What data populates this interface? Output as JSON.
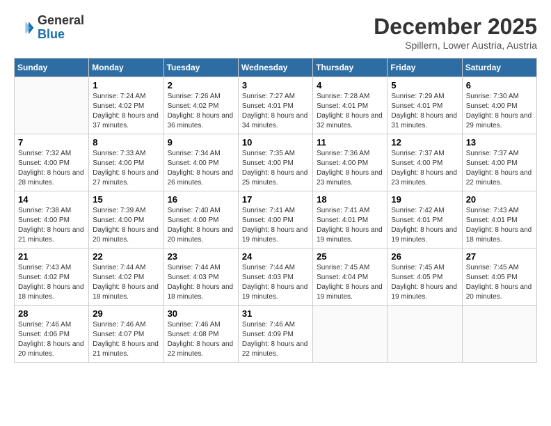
{
  "header": {
    "logo": {
      "general": "General",
      "blue": "Blue"
    },
    "title": "December 2025",
    "location": "Spillern, Lower Austria, Austria"
  },
  "weekdays": [
    "Sunday",
    "Monday",
    "Tuesday",
    "Wednesday",
    "Thursday",
    "Friday",
    "Saturday"
  ],
  "weeks": [
    [
      {
        "day": "",
        "sunrise": "",
        "sunset": "",
        "daylight": ""
      },
      {
        "day": "1",
        "sunrise": "Sunrise: 7:24 AM",
        "sunset": "Sunset: 4:02 PM",
        "daylight": "Daylight: 8 hours and 37 minutes."
      },
      {
        "day": "2",
        "sunrise": "Sunrise: 7:26 AM",
        "sunset": "Sunset: 4:02 PM",
        "daylight": "Daylight: 8 hours and 36 minutes."
      },
      {
        "day": "3",
        "sunrise": "Sunrise: 7:27 AM",
        "sunset": "Sunset: 4:01 PM",
        "daylight": "Daylight: 8 hours and 34 minutes."
      },
      {
        "day": "4",
        "sunrise": "Sunrise: 7:28 AM",
        "sunset": "Sunset: 4:01 PM",
        "daylight": "Daylight: 8 hours and 32 minutes."
      },
      {
        "day": "5",
        "sunrise": "Sunrise: 7:29 AM",
        "sunset": "Sunset: 4:01 PM",
        "daylight": "Daylight: 8 hours and 31 minutes."
      },
      {
        "day": "6",
        "sunrise": "Sunrise: 7:30 AM",
        "sunset": "Sunset: 4:00 PM",
        "daylight": "Daylight: 8 hours and 29 minutes."
      }
    ],
    [
      {
        "day": "7",
        "sunrise": "Sunrise: 7:32 AM",
        "sunset": "Sunset: 4:00 PM",
        "daylight": "Daylight: 8 hours and 28 minutes."
      },
      {
        "day": "8",
        "sunrise": "Sunrise: 7:33 AM",
        "sunset": "Sunset: 4:00 PM",
        "daylight": "Daylight: 8 hours and 27 minutes."
      },
      {
        "day": "9",
        "sunrise": "Sunrise: 7:34 AM",
        "sunset": "Sunset: 4:00 PM",
        "daylight": "Daylight: 8 hours and 26 minutes."
      },
      {
        "day": "10",
        "sunrise": "Sunrise: 7:35 AM",
        "sunset": "Sunset: 4:00 PM",
        "daylight": "Daylight: 8 hours and 25 minutes."
      },
      {
        "day": "11",
        "sunrise": "Sunrise: 7:36 AM",
        "sunset": "Sunset: 4:00 PM",
        "daylight": "Daylight: 8 hours and 23 minutes."
      },
      {
        "day": "12",
        "sunrise": "Sunrise: 7:37 AM",
        "sunset": "Sunset: 4:00 PM",
        "daylight": "Daylight: 8 hours and 23 minutes."
      },
      {
        "day": "13",
        "sunrise": "Sunrise: 7:37 AM",
        "sunset": "Sunset: 4:00 PM",
        "daylight": "Daylight: 8 hours and 22 minutes."
      }
    ],
    [
      {
        "day": "14",
        "sunrise": "Sunrise: 7:38 AM",
        "sunset": "Sunset: 4:00 PM",
        "daylight": "Daylight: 8 hours and 21 minutes."
      },
      {
        "day": "15",
        "sunrise": "Sunrise: 7:39 AM",
        "sunset": "Sunset: 4:00 PM",
        "daylight": "Daylight: 8 hours and 20 minutes."
      },
      {
        "day": "16",
        "sunrise": "Sunrise: 7:40 AM",
        "sunset": "Sunset: 4:00 PM",
        "daylight": "Daylight: 8 hours and 20 minutes."
      },
      {
        "day": "17",
        "sunrise": "Sunrise: 7:41 AM",
        "sunset": "Sunset: 4:00 PM",
        "daylight": "Daylight: 8 hours and 19 minutes."
      },
      {
        "day": "18",
        "sunrise": "Sunrise: 7:41 AM",
        "sunset": "Sunset: 4:01 PM",
        "daylight": "Daylight: 8 hours and 19 minutes."
      },
      {
        "day": "19",
        "sunrise": "Sunrise: 7:42 AM",
        "sunset": "Sunset: 4:01 PM",
        "daylight": "Daylight: 8 hours and 19 minutes."
      },
      {
        "day": "20",
        "sunrise": "Sunrise: 7:43 AM",
        "sunset": "Sunset: 4:01 PM",
        "daylight": "Daylight: 8 hours and 18 minutes."
      }
    ],
    [
      {
        "day": "21",
        "sunrise": "Sunrise: 7:43 AM",
        "sunset": "Sunset: 4:02 PM",
        "daylight": "Daylight: 8 hours and 18 minutes."
      },
      {
        "day": "22",
        "sunrise": "Sunrise: 7:44 AM",
        "sunset": "Sunset: 4:02 PM",
        "daylight": "Daylight: 8 hours and 18 minutes."
      },
      {
        "day": "23",
        "sunrise": "Sunrise: 7:44 AM",
        "sunset": "Sunset: 4:03 PM",
        "daylight": "Daylight: 8 hours and 18 minutes."
      },
      {
        "day": "24",
        "sunrise": "Sunrise: 7:44 AM",
        "sunset": "Sunset: 4:03 PM",
        "daylight": "Daylight: 8 hours and 19 minutes."
      },
      {
        "day": "25",
        "sunrise": "Sunrise: 7:45 AM",
        "sunset": "Sunset: 4:04 PM",
        "daylight": "Daylight: 8 hours and 19 minutes."
      },
      {
        "day": "26",
        "sunrise": "Sunrise: 7:45 AM",
        "sunset": "Sunset: 4:05 PM",
        "daylight": "Daylight: 8 hours and 19 minutes."
      },
      {
        "day": "27",
        "sunrise": "Sunrise: 7:45 AM",
        "sunset": "Sunset: 4:05 PM",
        "daylight": "Daylight: 8 hours and 20 minutes."
      }
    ],
    [
      {
        "day": "28",
        "sunrise": "Sunrise: 7:46 AM",
        "sunset": "Sunset: 4:06 PM",
        "daylight": "Daylight: 8 hours and 20 minutes."
      },
      {
        "day": "29",
        "sunrise": "Sunrise: 7:46 AM",
        "sunset": "Sunset: 4:07 PM",
        "daylight": "Daylight: 8 hours and 21 minutes."
      },
      {
        "day": "30",
        "sunrise": "Sunrise: 7:46 AM",
        "sunset": "Sunset: 4:08 PM",
        "daylight": "Daylight: 8 hours and 22 minutes."
      },
      {
        "day": "31",
        "sunrise": "Sunrise: 7:46 AM",
        "sunset": "Sunset: 4:09 PM",
        "daylight": "Daylight: 8 hours and 22 minutes."
      },
      {
        "day": "",
        "sunrise": "",
        "sunset": "",
        "daylight": ""
      },
      {
        "day": "",
        "sunrise": "",
        "sunset": "",
        "daylight": ""
      },
      {
        "day": "",
        "sunrise": "",
        "sunset": "",
        "daylight": ""
      }
    ]
  ]
}
